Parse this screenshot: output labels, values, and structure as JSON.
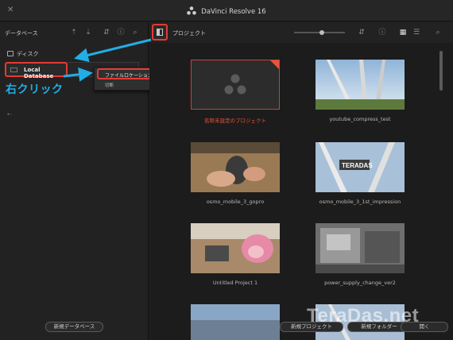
{
  "window": {
    "title": "DaVinci Resolve 16"
  },
  "left_panel": {
    "toolbar_label": "データベース",
    "section_label": "ディスク",
    "database_item": "Local Database",
    "new_database_button": "新規データベース"
  },
  "context_menu": {
    "items": [
      "ファイルロケーションを開く",
      "切断"
    ]
  },
  "annotation": {
    "label": "右クリック",
    "color": "#21aee6"
  },
  "main_panel": {
    "toolbar_label": "プロジェクト",
    "zoom_level": 0.55,
    "projects": [
      {
        "name": "名称未設定のプロジェクト",
        "selected": true
      },
      {
        "name": "youtube_compress_test"
      },
      {
        "name": "osmo_mobile_3_gopro"
      },
      {
        "name": "osmo_mobile_3_1st_impression"
      },
      {
        "name": "Untitled Project 1"
      },
      {
        "name": "power_supply_change_ver2"
      }
    ],
    "new_project_button": "新規プロジェクト",
    "new_folder_button": "新規フォルダー",
    "open_button": "開く"
  },
  "watermark": "TeraDas.net",
  "colors": {
    "highlight_red": "#e53a34",
    "accent_orange": "#e5553a",
    "arrow_blue": "#21aee6"
  }
}
